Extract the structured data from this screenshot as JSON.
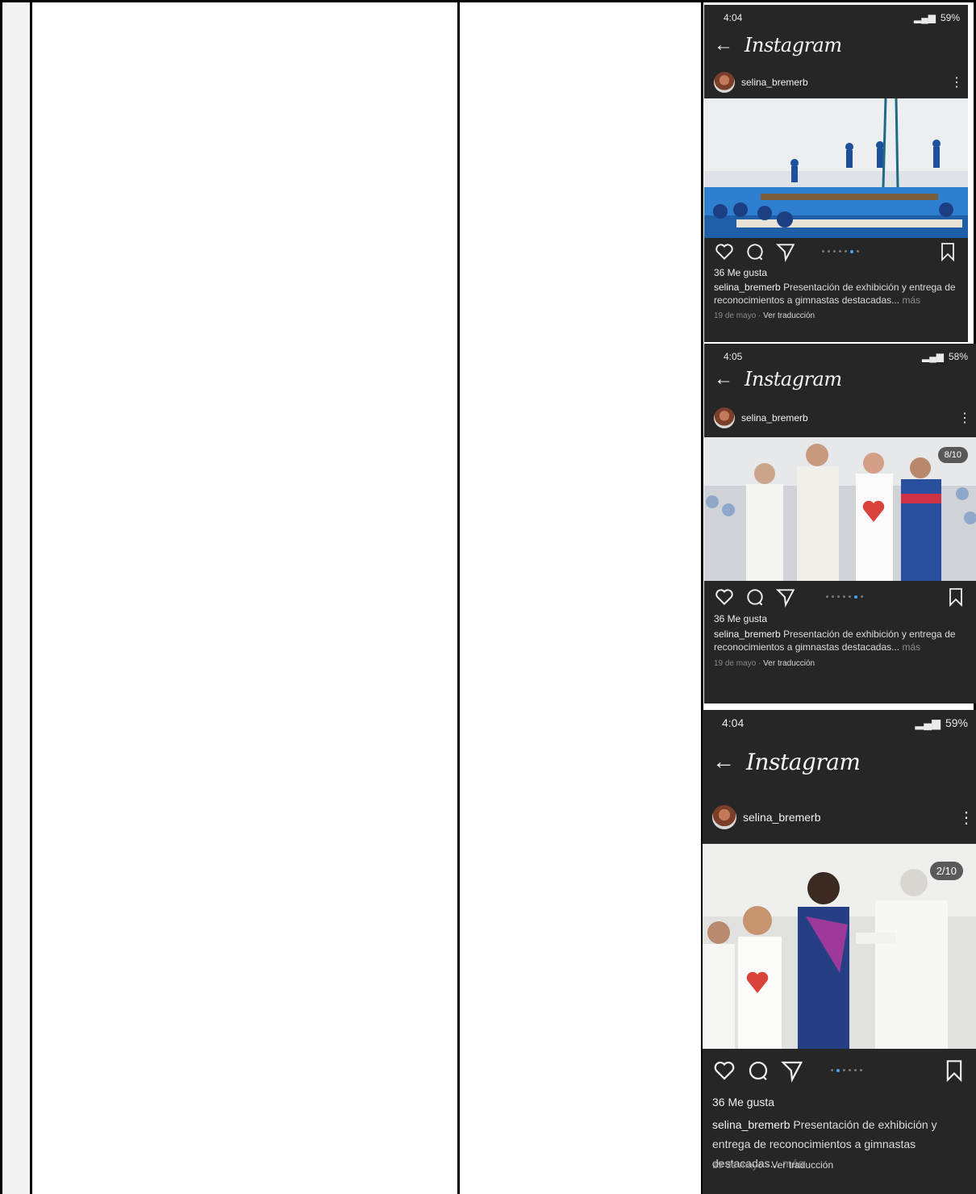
{
  "table": {
    "columns": 4
  },
  "screenshots": [
    {
      "status_time": "4:04",
      "status_battery": "59%",
      "back_icon": "back-arrow-icon",
      "app_title": "Instagram",
      "username": "selina_bremerb",
      "counter": "",
      "likes": "36 Me gusta",
      "caption_user": "selina_bremerb",
      "caption_text": "Presentación de exhibición y entrega de reconocimientos a gimnastas destacadas...",
      "caption_more": "más",
      "date": "19 de mayo",
      "separator": "·",
      "translate": "Ver traducción"
    },
    {
      "status_time": "4:05",
      "status_battery": "58%",
      "back_icon": "back-arrow-icon",
      "app_title": "Instagram",
      "username": "selina_bremerb",
      "counter": "8/10",
      "likes": "36 Me gusta",
      "caption_user": "selina_bremerb",
      "caption_text": "Presentación de exhibición y entrega de reconocimientos a gimnastas destacadas...",
      "caption_more": "más",
      "date": "19 de mayo",
      "separator": "·",
      "translate": "Ver traducción"
    },
    {
      "status_time": "4:04",
      "status_battery": "59%",
      "back_icon": "back-arrow-icon",
      "app_title": "Instagram",
      "username": "selina_bremerb",
      "counter": "2/10",
      "likes": "36 Me gusta",
      "caption_user": "selina_bremerb",
      "caption_text": "Presentación de exhibición y entrega de reconocimientos a gimnastas destacadas...",
      "caption_more": "más",
      "date": "19 de mayo",
      "separator": "·",
      "translate": "Ver traducción"
    }
  ],
  "colors": {
    "app_bg": "#262626",
    "dot_active": "#4aa3f0",
    "table_line": "#000000"
  }
}
